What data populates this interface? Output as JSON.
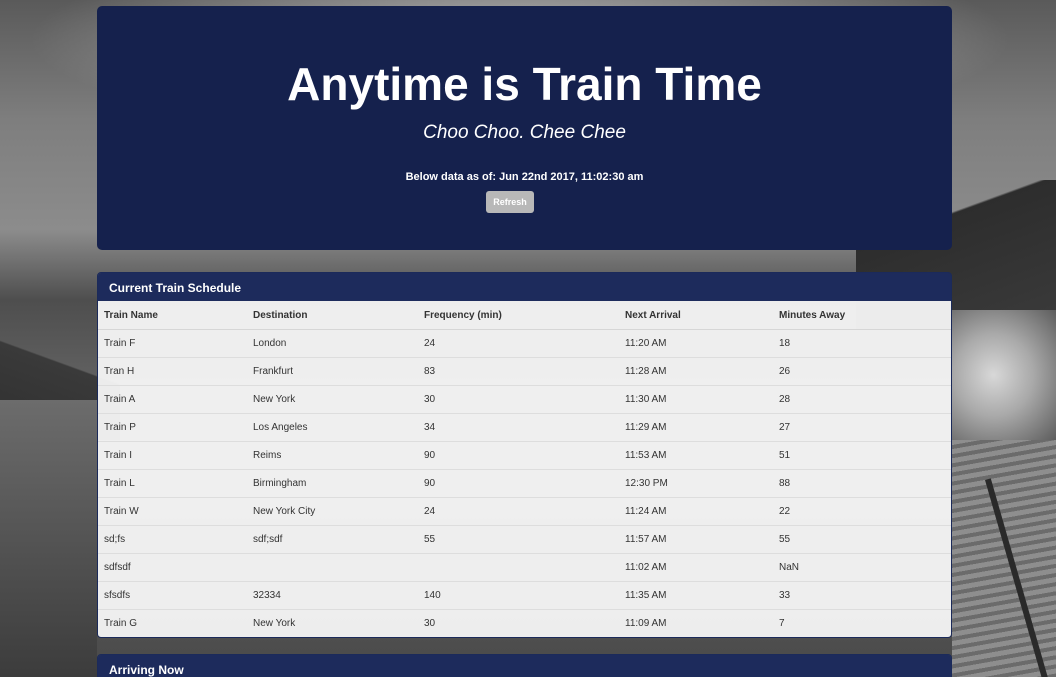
{
  "header": {
    "title": "Anytime is Train Time",
    "subtitle": "Choo Choo. Chee Chee",
    "as_of": "Below data as of: Jun 22nd 2017, 11:02:30 am",
    "refresh_label": "Refresh"
  },
  "schedule": {
    "heading": "Current Train Schedule",
    "columns": [
      "Train Name",
      "Destination",
      "Frequency (min)",
      "Next Arrival",
      "Minutes Away"
    ],
    "rows": [
      [
        "Train F",
        "London",
        "24",
        "11:20 AM",
        "18"
      ],
      [
        "Tran H",
        "Frankfurt",
        "83",
        "11:28 AM",
        "26"
      ],
      [
        "Train A",
        "New York",
        "30",
        "11:30 AM",
        "28"
      ],
      [
        "Train P",
        "Los Angeles",
        "34",
        "11:29 AM",
        "27"
      ],
      [
        "Train I",
        "Reims",
        "90",
        "11:53 AM",
        "51"
      ],
      [
        "Train L",
        "Birmingham",
        "90",
        "12:30 PM",
        "88"
      ],
      [
        "Train W",
        "New York City",
        "24",
        "11:24 AM",
        "22"
      ],
      [
        "sd;fs",
        "sdf;sdf",
        "55",
        "11:57 AM",
        "55"
      ],
      [
        "sdfsdf",
        "",
        "",
        "11:02 AM",
        "NaN"
      ],
      [
        "sfsdfs",
        "32334",
        "140",
        "11:35 AM",
        "33"
      ],
      [
        "Train G",
        "New York",
        "30",
        "11:09 AM",
        "7"
      ]
    ]
  },
  "arriving": {
    "heading": "Arriving Now"
  },
  "colors": {
    "jumbotron_bg": "#15214d",
    "panel_heading_bg": "#1d2b5c",
    "refresh_button_bg": "#b8b8b8"
  }
}
